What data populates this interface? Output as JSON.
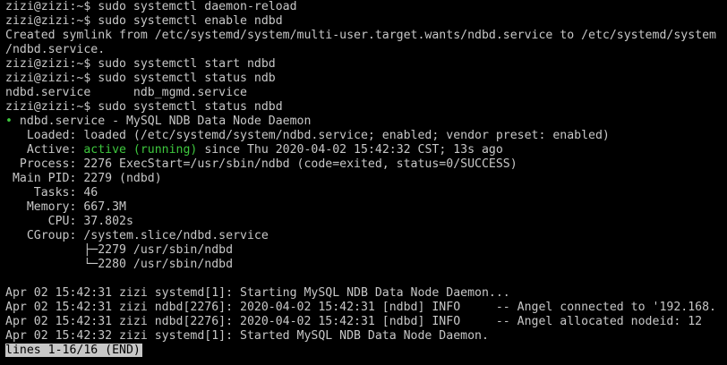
{
  "colors": {
    "background": "#000000",
    "text": "#c7c7c7",
    "status_green": "#3ec73e",
    "pager_bg": "#c7c7c7"
  },
  "terminal": {
    "cmd1": "zizi@zizi:~$ sudo systemctl daemon-reload",
    "cmd2": "zizi@zizi:~$ sudo systemctl enable ndbd",
    "symlink1": "Created symlink from /etc/systemd/system/multi-user.target.wants/ndbd.service to /etc/systemd/system",
    "symlink2": "/ndbd.service.",
    "cmd3": "zizi@zizi:~$ sudo systemctl start ndbd",
    "cmd4": "zizi@zizi:~$ sudo systemctl status ndb",
    "completion": "ndbd.service      ndb_mgmd.service",
    "cmd5": "zizi@zizi:~$ sudo systemctl status ndbd",
    "status_dot": "•",
    "service_title": " ndbd.service - MySQL NDB Data Node Daemon",
    "loaded": "   Loaded: loaded (/etc/systemd/system/ndbd.service; enabled; vendor preset: enabled)",
    "active_prefix": "   Active: ",
    "active_state": "active (running)",
    "active_suffix": " since Thu 2020-04-02 15:42:32 CST; 13s ago",
    "process": "  Process: 2276 ExecStart=/usr/sbin/ndbd (code=exited, status=0/SUCCESS)",
    "main_pid": " Main PID: 2279 (ndbd)",
    "tasks": "    Tasks: 46",
    "memory": "   Memory: 667.3M",
    "cpu": "      CPU: 37.802s",
    "cgroup": "   CGroup: /system.slice/ndbd.service",
    "cgroup_child1": "           ├─2279 /usr/sbin/ndbd",
    "cgroup_child2": "           └─2280 /usr/sbin/ndbd",
    "log1": "Apr 02 15:42:31 zizi systemd[1]: Starting MySQL NDB Data Node Daemon...",
    "log2": "Apr 02 15:42:31 zizi ndbd[2276]: 2020-04-02 15:42:31 [ndbd] INFO     -- Angel connected to '192.168.",
    "log3": "Apr 02 15:42:31 zizi ndbd[2276]: 2020-04-02 15:42:31 [ndbd] INFO     -- Angel allocated nodeid: 12",
    "log4": "Apr 02 15:42:32 zizi systemd[1]: Started MySQL NDB Data Node Daemon.",
    "pager_status": "lines 1-16/16 (END)"
  }
}
